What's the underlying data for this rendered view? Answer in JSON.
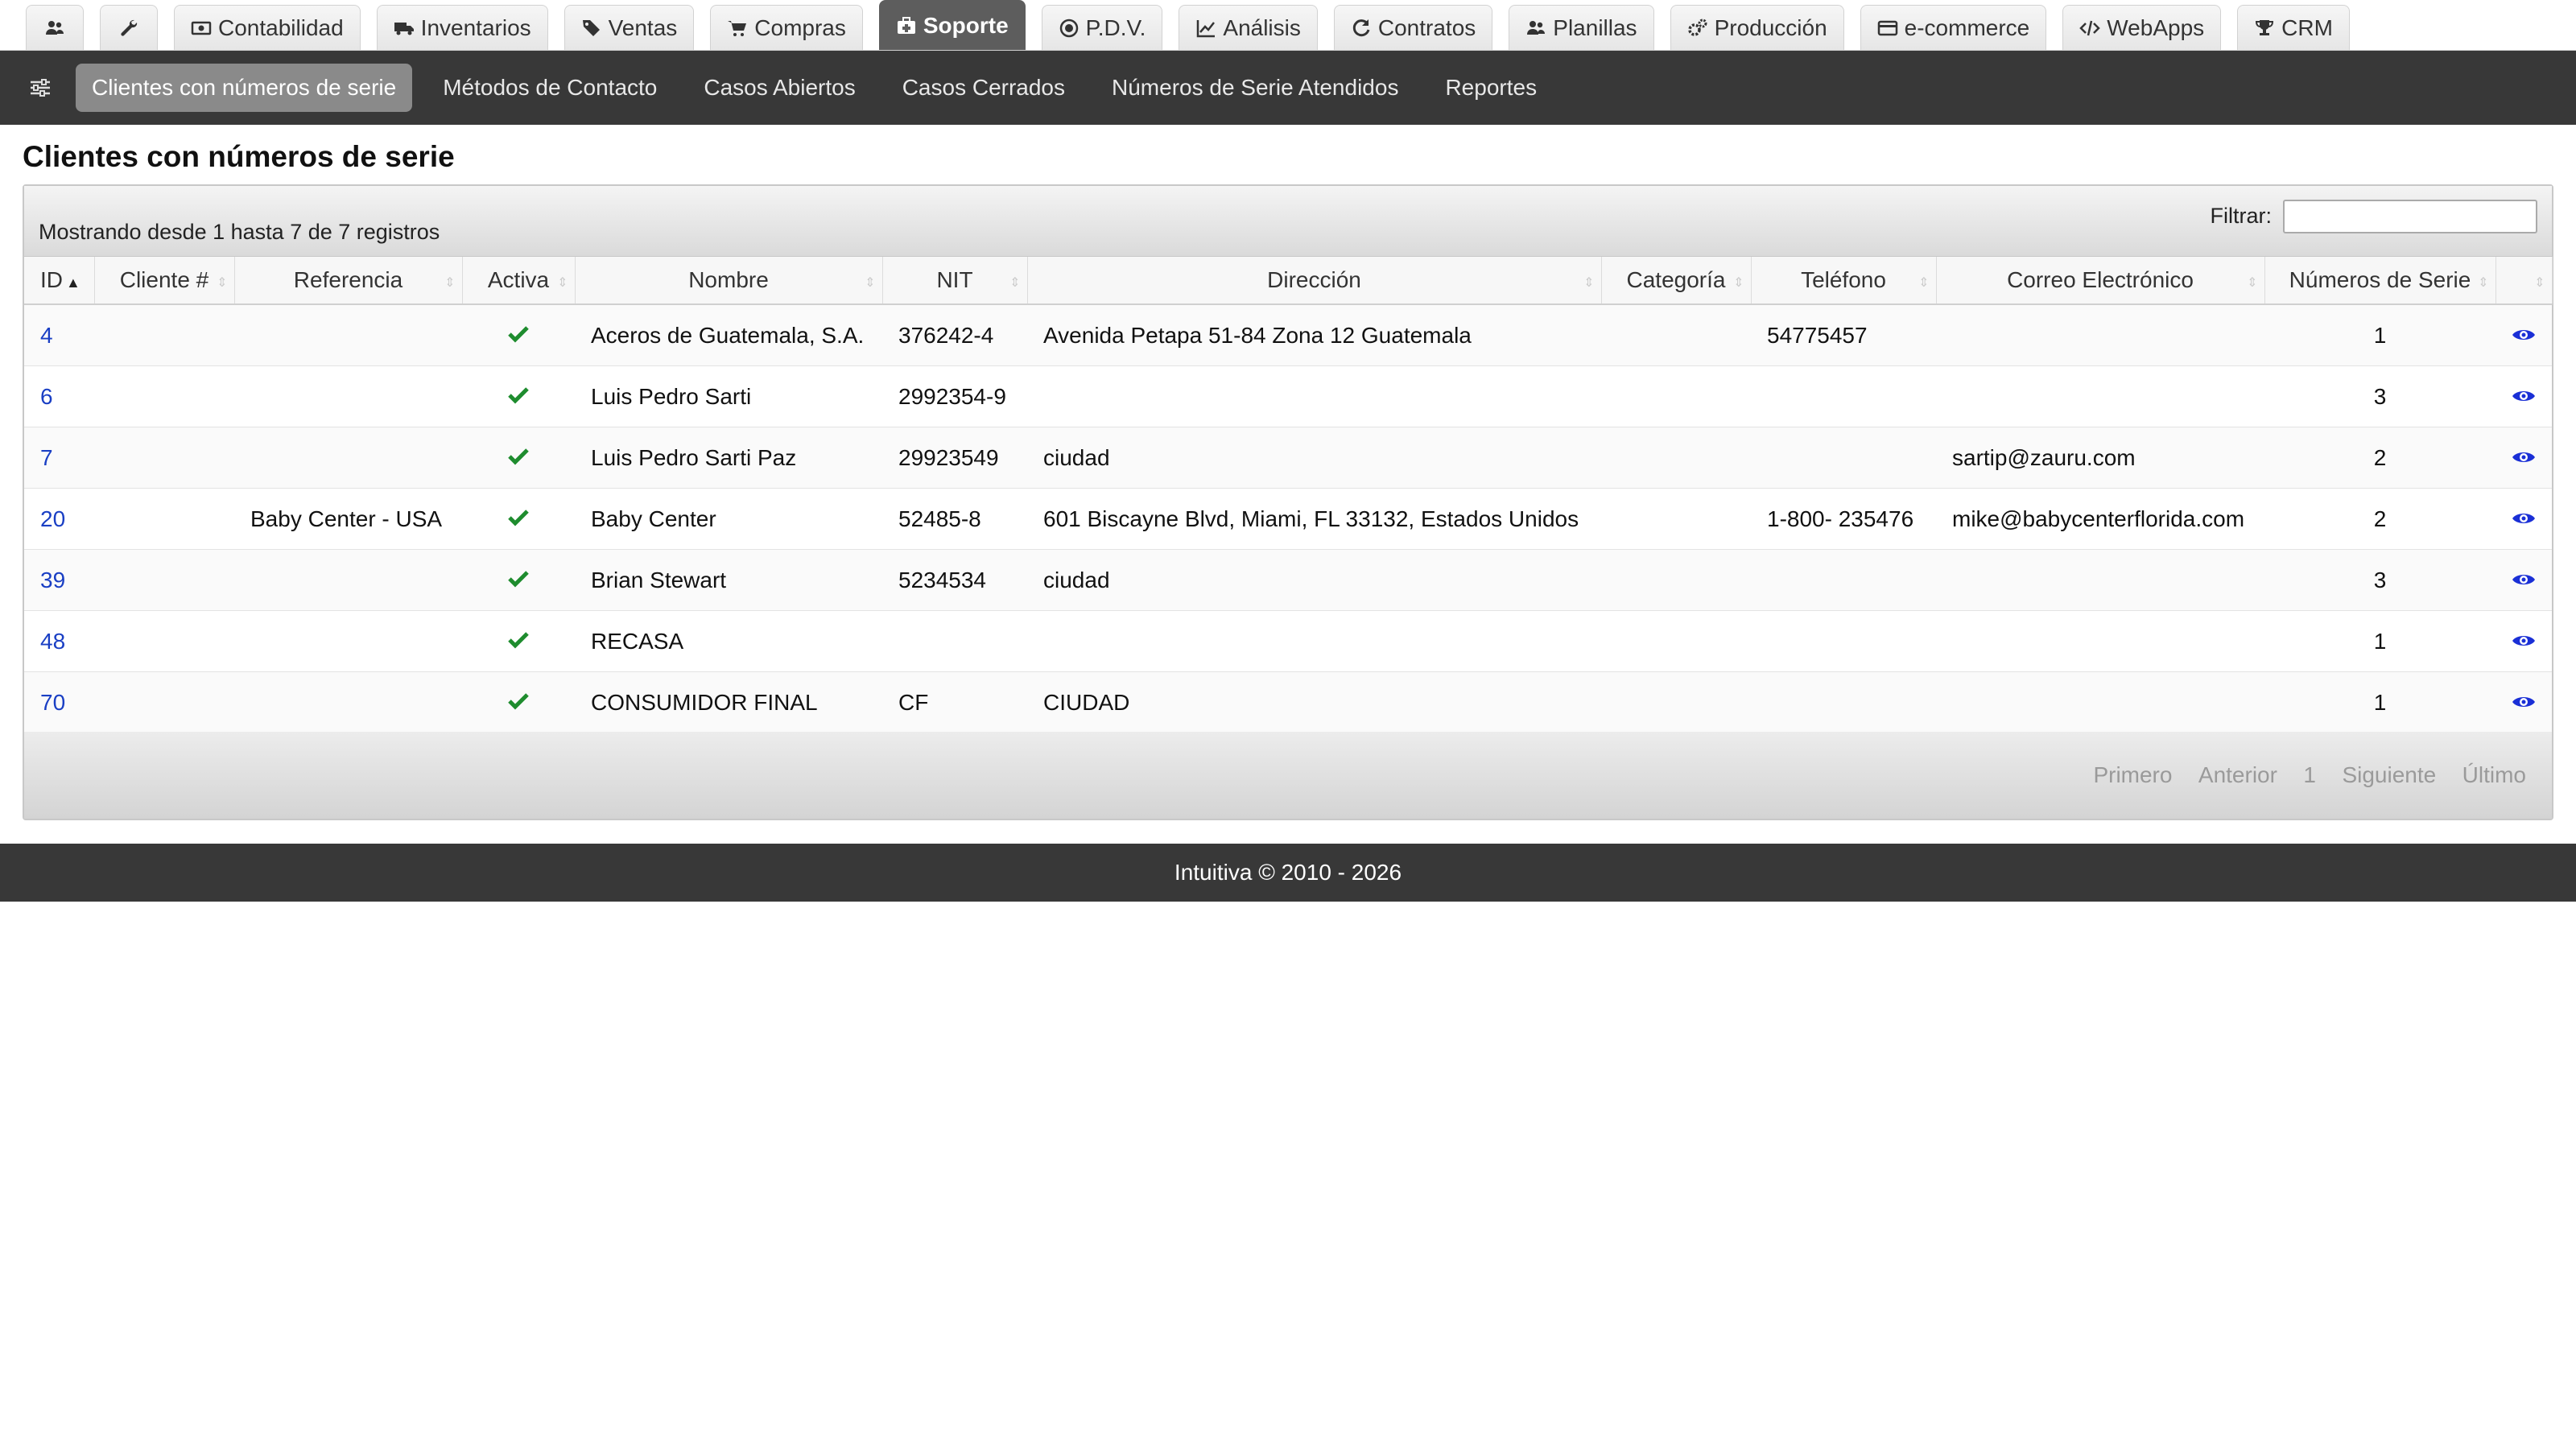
{
  "top_tabs": [
    {
      "label": "",
      "icon": "users-icon",
      "active": false
    },
    {
      "label": "",
      "icon": "wrench-icon",
      "active": false
    },
    {
      "label": "Contabilidad",
      "icon": "money-icon",
      "active": false
    },
    {
      "label": "Inventarios",
      "icon": "truck-icon",
      "active": false
    },
    {
      "label": "Ventas",
      "icon": "tags-icon",
      "active": false
    },
    {
      "label": "Compras",
      "icon": "cart-icon",
      "active": false
    },
    {
      "label": "Soporte",
      "icon": "medkit-icon",
      "active": true
    },
    {
      "label": "P.D.V.",
      "icon": "target-icon",
      "active": false
    },
    {
      "label": "Análisis",
      "icon": "line-chart-icon",
      "active": false
    },
    {
      "label": "Contratos",
      "icon": "refresh-icon",
      "active": false
    },
    {
      "label": "Planillas",
      "icon": "users-icon",
      "active": false
    },
    {
      "label": "Producción",
      "icon": "cogs-icon",
      "active": false
    },
    {
      "label": "e-commerce",
      "icon": "credit-card-icon",
      "active": false
    },
    {
      "label": "WebApps",
      "icon": "code-icon",
      "active": false
    },
    {
      "label": "CRM",
      "icon": "trophy-icon",
      "active": false
    }
  ],
  "sub_nav": {
    "items": [
      {
        "label": "Clientes con números de serie",
        "active": true
      },
      {
        "label": "Métodos de Contacto",
        "active": false
      },
      {
        "label": "Casos Abiertos",
        "active": false
      },
      {
        "label": "Casos Cerrados",
        "active": false
      },
      {
        "label": "Números de Serie Atendidos",
        "active": false
      },
      {
        "label": "Reportes",
        "active": false
      }
    ]
  },
  "page": {
    "title": "Clientes con números de serie",
    "info": "Mostrando desde 1 hasta 7 de 7 registros",
    "filter_label": "Filtrar:",
    "filter_value": ""
  },
  "table": {
    "columns": [
      "ID",
      "Cliente #",
      "Referencia",
      "Activa",
      "Nombre",
      "NIT",
      "Dirección",
      "Categoría",
      "Teléfono",
      "Correo Electrónico",
      "Números de Serie",
      ""
    ],
    "rows": [
      {
        "id": "4",
        "cliente": "",
        "referencia": "",
        "activa": true,
        "nombre": "Aceros de Guatemala, S.A.",
        "nit": "376242-4",
        "direccion": "Avenida Petapa 51-84 Zona 12 Guatemala",
        "categoria": "",
        "telefono": "54775457",
        "correo": "",
        "series": "1"
      },
      {
        "id": "6",
        "cliente": "",
        "referencia": "",
        "activa": true,
        "nombre": "Luis Pedro Sarti",
        "nit": "2992354-9",
        "direccion": "",
        "categoria": "",
        "telefono": "",
        "correo": "",
        "series": "3"
      },
      {
        "id": "7",
        "cliente": "",
        "referencia": "",
        "activa": true,
        "nombre": "Luis Pedro Sarti Paz",
        "nit": "29923549",
        "direccion": "ciudad",
        "categoria": "",
        "telefono": "",
        "correo": "sartip@zauru.com",
        "series": "2"
      },
      {
        "id": "20",
        "cliente": "",
        "referencia": "Baby Center - USA",
        "activa": true,
        "nombre": "Baby Center",
        "nit": "52485-8",
        "direccion": "601 Biscayne Blvd, Miami, FL 33132, Estados Unidos",
        "categoria": "",
        "telefono": "1-800- 235476",
        "correo": "mike@babycenterflorida.com",
        "series": "2"
      },
      {
        "id": "39",
        "cliente": "",
        "referencia": "",
        "activa": true,
        "nombre": "Brian Stewart",
        "nit": "5234534",
        "direccion": "ciudad",
        "categoria": "",
        "telefono": "",
        "correo": "",
        "series": "3"
      },
      {
        "id": "48",
        "cliente": "",
        "referencia": "",
        "activa": true,
        "nombre": "RECASA",
        "nit": "",
        "direccion": "",
        "categoria": "",
        "telefono": "",
        "correo": "",
        "series": "1"
      },
      {
        "id": "70",
        "cliente": "",
        "referencia": "",
        "activa": true,
        "nombre": "CONSUMIDOR FINAL",
        "nit": "CF",
        "direccion": "CIUDAD",
        "categoria": "",
        "telefono": "",
        "correo": "",
        "series": "1"
      }
    ]
  },
  "pagination": {
    "first": "Primero",
    "prev": "Anterior",
    "page": "1",
    "next": "Siguiente",
    "last": "Último"
  },
  "footer": {
    "text": "Intuitiva © 2010 - 2026"
  },
  "colors": {
    "active_tab": "#5d5d5d",
    "nav_bg": "#383838",
    "link": "#1a3fc4",
    "check": "#1e8c2e",
    "eye": "#1a2fd6"
  }
}
